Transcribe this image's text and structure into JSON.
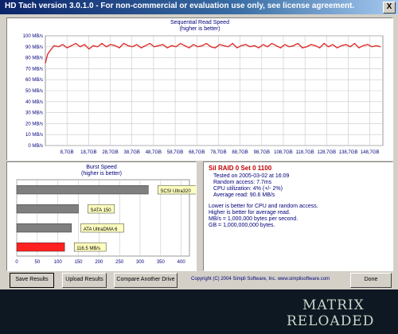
{
  "window": {
    "title": "HD Tach version 3.0.1.0 - For non-commercial or evaluation use only, see license agreement.",
    "close_label": "X"
  },
  "sequential": {
    "title": "Sequential Read Speed",
    "subtitle": "(higher is better)",
    "color": "#e0302f"
  },
  "burst": {
    "title": "Burst Speed",
    "subtitle": "(higher is better)",
    "bar_color_ref": "#7f7f7f",
    "bar_color_this": "#ff2020"
  },
  "info": {
    "device": "Sil RAID 0 Set 0 1100",
    "tested": "Tested on 2005-03-02 at 16:09",
    "random_access": "Random access: 7.7ms",
    "cpu": "CPU utilization: 4% (+/- 2%)",
    "avg_read": "Average read: 90.6 MB/s",
    "note1": "Lower is better for CPU and random access.",
    "note2": "Higher is better for average read.",
    "note3": "MB/s = 1,000,000 bytes per second.",
    "note4": "GB = 1,000,000,000 bytes."
  },
  "buttons": {
    "save": "Save Results",
    "upload": "Upload Results",
    "compare": "Compare Another Drive",
    "done": "Done"
  },
  "copyright": "Copyright (C) 2004 Simpli Software, Inc. www.simplisoftware.com",
  "watermark": {
    "line1": "MATRIX",
    "line2": "RELOADED"
  },
  "chart_data": [
    {
      "type": "line",
      "title": "Sequential Read Speed",
      "subtitle": "(higher is better)",
      "y_tick_labels": [
        "0 MB/s",
        "10 MB/s",
        "20 MB/s",
        "30 MB/s",
        "40 MB/s",
        "50 MB/s",
        "60 MB/s",
        "70 MB/s",
        "80 MB/s",
        "90 MB/s",
        "100 MB/s"
      ],
      "x_tick_labels": [
        "8,7GB",
        "18,7GB",
        "28,7GB",
        "38,7GB",
        "48,7GB",
        "58,7GB",
        "68,7GB",
        "78,7GB",
        "88,7GB",
        "98,7GB",
        "108,7GB",
        "118,7GB",
        "128,7GB",
        "138,7GB",
        "148,7GB"
      ],
      "ylim": [
        0,
        100
      ],
      "xlim": [
        0,
        155
      ],
      "grid": true,
      "x": [
        0,
        1,
        2,
        4,
        6,
        8,
        10,
        12,
        14,
        16,
        18,
        20,
        22,
        24,
        26,
        28,
        30,
        32,
        34,
        36,
        38,
        40,
        42,
        44,
        46,
        48,
        50,
        52,
        54,
        56,
        58,
        60,
        62,
        64,
        66,
        68,
        70,
        72,
        74,
        76,
        78,
        80,
        82,
        84,
        86,
        88,
        90,
        92,
        94,
        96,
        98,
        100,
        102,
        104,
        106,
        108,
        110,
        112,
        114,
        116,
        118,
        120,
        122,
        124,
        126,
        128,
        130,
        132,
        134,
        136,
        138,
        140,
        142,
        144,
        146,
        148,
        150,
        152,
        154
      ],
      "values": [
        75,
        83,
        86,
        91,
        90,
        92,
        89,
        91,
        93,
        90,
        92,
        88,
        91,
        90,
        93,
        90,
        92,
        91,
        89,
        93,
        91,
        90,
        92,
        89,
        91,
        93,
        90,
        91,
        92,
        89,
        91,
        90,
        93,
        91,
        89,
        92,
        90,
        91,
        93,
        90,
        89,
        92,
        91,
        90,
        93,
        89,
        91,
        92,
        90,
        91,
        89,
        92,
        90,
        93,
        91,
        89,
        92,
        90,
        91,
        93,
        89,
        90,
        92,
        91,
        89,
        93,
        90,
        92,
        89,
        91,
        92,
        90,
        93,
        89,
        91,
        92,
        90,
        91,
        90
      ]
    },
    {
      "type": "bar",
      "title": "Burst Speed",
      "subtitle": "(higher is better)",
      "orientation": "horizontal",
      "categories": [
        "SCSI Ultra320",
        "SATA 150",
        "ATA UltraDMA 6",
        ""
      ],
      "values": [
        320,
        150,
        133,
        116.5
      ],
      "data_labels": [
        "SCSI Ultra320",
        "SATA 150",
        "ATA UltraDMA 6",
        "116.5 MB/s"
      ],
      "x_tick_labels": [
        "0",
        "50",
        "100",
        "150",
        "200",
        "250",
        "300",
        "350",
        "400"
      ],
      "xlim": [
        0,
        420
      ],
      "grid": true
    }
  ]
}
